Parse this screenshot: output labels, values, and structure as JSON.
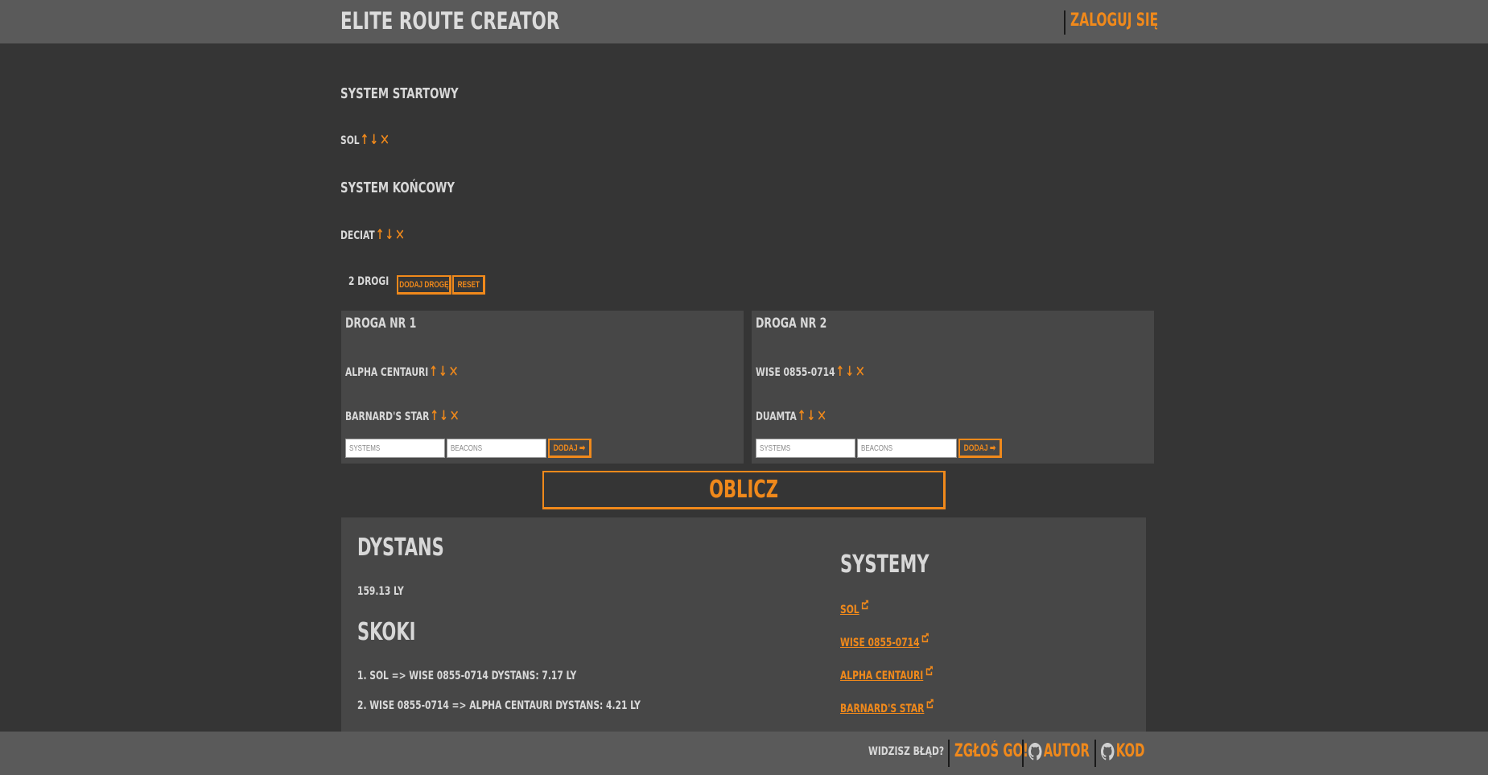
{
  "header": {
    "title": "ELITE ROUTE CREATOR",
    "login_label": "ZALOGUJ SIĘ"
  },
  "start": {
    "heading": "SYSTEM STARTOWY",
    "system": "SOL"
  },
  "end": {
    "heading": "SYSTEM KOŃCOWY",
    "system": "DECIAT"
  },
  "controls": {
    "up": "↑",
    "down": "↓",
    "remove": "✕"
  },
  "routes_bar": {
    "count_label": "2 DROGI",
    "add_route_label": "DODAJ DROGĘ",
    "reset_label": "RESET"
  },
  "routes": [
    {
      "title": "DROGA NR 1",
      "systems": [
        "ALPHA CENTAURI",
        "BARNARD'S STAR"
      ],
      "systems_placeholder": "SYSTEMS",
      "beacons_placeholder": "BEACONS",
      "add_label": "DODAJ ➡"
    },
    {
      "title": "DROGA NR 2",
      "systems": [
        "WISE 0855-0714",
        "DUAMTA"
      ],
      "systems_placeholder": "SYSTEMS",
      "beacons_placeholder": "BEACONS",
      "add_label": "DODAJ ➡"
    }
  ],
  "calculate_label": "OBLICZ",
  "results": {
    "distance_heading": "DYSTANS",
    "distance_value": "159.13 LY",
    "jumps_heading": "SKOKI",
    "jumps": [
      "1. SOL => WISE 0855-0714 DYSTANS: 7.17 LY",
      "2. WISE 0855-0714 => ALPHA CENTAURI DYSTANS: 4.21 LY"
    ],
    "systems_heading": "SYSTEMY",
    "systems": [
      "SOL",
      "WISE 0855-0714",
      "ALPHA CENTAURI",
      "BARNARD'S STAR"
    ]
  },
  "footer": {
    "question": "WIDZISZ BŁĄD?",
    "report_label": "ZGŁOŚ GO!",
    "author_label": "AUTOR",
    "code_label": "KOD"
  },
  "colors": {
    "accent": "#f0891b",
    "bar": "#5a5a5a",
    "background": "#353535",
    "panel": "#474747"
  }
}
